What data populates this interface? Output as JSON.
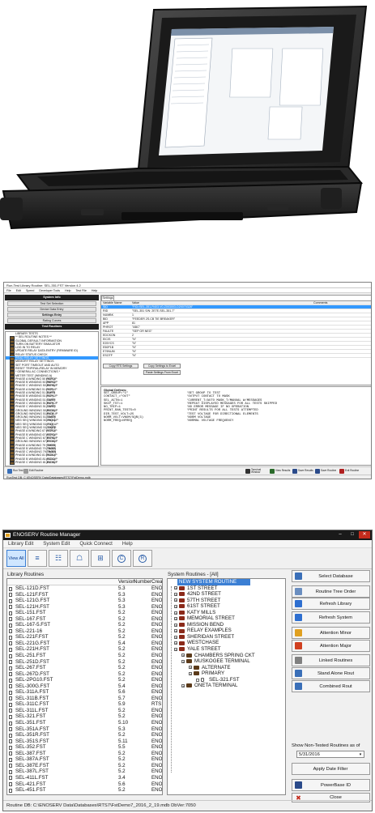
{
  "laptop_photo": {
    "description_icon": "rugged-laptop-photo"
  },
  "runtest": {
    "title": "Run-Test Library Routine: SEL-351.FST  Version 4.2",
    "menu": [
      "File",
      "Edit",
      "Speed",
      "Developer Tools",
      "Help",
      "Test File",
      "Help"
    ],
    "left": {
      "system_info": "System Info",
      "buttons": [
        "Test Set Selection",
        "Device Data Entry",
        "Settings Entry",
        "Rating Curves"
      ],
      "test_routines": "Test Routines",
      "tree": [
        {
          "label": "LIBRARY TESTS",
          "fst": ""
        },
        {
          "label": "** SEL ROUTINE NOTES **",
          "fst": ""
        },
        {
          "label": "GLOBAL DEFAULT INFORMATION",
          "fst": ""
        },
        {
          "label": "TURN ON BATTERY SIMULATOR",
          "fst": ""
        },
        {
          "label": "LOG IN TO RELAY",
          "fst": ""
        },
        {
          "label": "UPDATE RELAY DATA ENTRY (FIRMWARE ID)",
          "fst": ""
        },
        {
          "label": "RELAY STATUS CHECK",
          "fst": ""
        },
        {
          "label": "READ RELAY SETTINGS",
          "fst": "",
          "highlight": true
        },
        {
          "label": "MEMORY RELAY SETTINGS",
          "fst": ""
        },
        {
          "label": "SET PORT TIMEOUT AND AUTO",
          "fst": ""
        },
        {
          "label": "RESET TRIP/FAIL/RELAY IN MEMORY",
          "fst": ""
        },
        {
          "label": "* GENERAL AC CONNECTIONS *",
          "fst": ""
        },
        {
          "label": "METER TEST (WINDING A)",
          "fst": ""
        },
        {
          "label": "PHASE A WINDING 50 PICKUP",
          "fst": "(50P1)"
        },
        {
          "label": "PHASE B WINDING 50 PICKUP",
          "fst": "(50P2)"
        },
        {
          "label": "PHASE C WINDING 50 PICKUP",
          "fst": "(50P3)"
        },
        {
          "label": "PHASE A WINDING 51 PICKUP",
          "fst": "(51P)"
        },
        {
          "label": "PHASE A WINDING 51 TIMER",
          "fst": "(51PT)"
        },
        {
          "label": "PHASE B WINDING 51 PICKUP",
          "fst": "(51P)"
        },
        {
          "label": "PHASE B WINDING 51 TIMER",
          "fst": "(51PT)"
        },
        {
          "label": "PHASE C WINDING 51 PICKUP",
          "fst": "(51P)"
        },
        {
          "label": "PHASE C WINDING 51 TIMER",
          "fst": "(51PT)"
        },
        {
          "label": "GROUND WINDING 50 PICKUP",
          "fst": "(50G1)"
        },
        {
          "label": "GROUND WINDING 51 PICKUP",
          "fst": "(51G)"
        },
        {
          "label": "GROUND WINDING 51 TIMER",
          "fst": "(51GT)"
        },
        {
          "label": "NEG SEQ WINDING 50 PICKUP",
          "fst": "(50Q1)"
        },
        {
          "label": "NEG SEQ WINDING 51 PICKUP",
          "fst": "(51Q)"
        },
        {
          "label": "NEG SEQ WINDING 51 TIMER",
          "fst": "(51QT)"
        },
        {
          "label": "PHASE A WINDING 67 PICKUP",
          "fst": "(67P1)"
        },
        {
          "label": "PHASE B WINDING 67 PICKUP",
          "fst": "(67P2)"
        },
        {
          "label": "PHASE C WINDING 67 PICKUP",
          "fst": "(67P3)"
        },
        {
          "label": "GROUND WINDING 67 PICKUP",
          "fst": "(67G1)"
        },
        {
          "label": "PHASE A WINDING 79 TIMER",
          "fst": "(79OI1)"
        },
        {
          "label": "PHASE B WINDING 79 TIMER",
          "fst": "(79OI2)"
        },
        {
          "label": "PHASE C WINDING 79 TIMER",
          "fst": "(79OI3)"
        },
        {
          "label": "PHASE A WINDING 81 PICKUP",
          "fst": "(81D1)"
        },
        {
          "label": "PHASE B WINDING 81 PICKUP",
          "fst": "(81D2)"
        },
        {
          "label": "PHASE C WINDING 81 PICKUP",
          "fst": "(81D3)"
        }
      ]
    },
    "settings": {
      "tab": "Settings",
      "columns": [
        "Variable Name",
        "Value",
        "Comments"
      ],
      "rows": [
        {
          "name": "SID",
          "value": "\"FID=SEL-351-R403-V0-Z003003-D20070328\"",
          "selected": true
        },
        {
          "name": "RID",
          "value": "\"SEL-351 S/N: 2E7E-SEL-351-7\""
        },
        {
          "name": "NUMBK",
          "value": "1"
        },
        {
          "name": "BID",
          "value": "\"FEEDER 2S.CB TIE BREAKER\""
        },
        {
          "name": "APP",
          "value": "81"
        },
        {
          "name": "PHROT",
          "value": "\"ABC\""
        },
        {
          "name": "FAULTE",
          "value": "\"SEP OR NEG\""
        },
        {
          "name": "EDCKON",
          "value": "2"
        },
        {
          "name": "EICIS",
          "value": "\"N\""
        },
        {
          "name": "E25YCS",
          "value": "\"N\""
        },
        {
          "name": "E50P1B",
          "value": "\"N\""
        },
        {
          "name": "E79NUM",
          "value": "\"N\""
        },
        {
          "name": "ESOTF",
          "value": "\"N\""
        }
      ],
      "btn_copy_rts": "Copy RTS Settings",
      "btn_copy_excel": "Copy Settings to Excel",
      "btn_paste": "Paste Settings From Excel"
    },
    "globals": {
      "heading": "Global Defines:",
      "lines": [
        {
          "name": "SET_GROUP=\"1\"",
          "value": "'SET GROUP TO TEST"
        },
        {
          "name": "CONTACT_=\"OUT\"",
          "value": "'OUTPUT CONTACT TO MASK"
        },
        {
          "name": "SEL_ACTN=1",
          "value": "'CURRENT_T/AUTO MASK_T/MANUAL W/MESSAGES"
        },
        {
          "name": "SKIP_TST=1",
          "value": "'REPEAT DISPLAYED MESSAGES FOR ALL TESTS SKIPPED"
        },
        {
          "name": "NO_TRIP=1",
          "value": "'NO ERROR MESSAGE IF NO OPERATION"
        },
        {
          "name": "PRINT_RAN_TESTS=0",
          "value": "'PRINT RESULTS FOR ALL TESTS ATTEMPTED"
        },
        {
          "name": "DIR_TEST_VOLT=25",
          "value": "'TEST VOLTAGE FOR DIRECTIONAL ELEMENTS"
        },
        {
          "name": "NORM_VOLT=VNOM/SQR(3)",
          "value": "'NORM VOLTAGE"
        },
        {
          "name": "NORM_FREQ=NFREQ",
          "value": "'NORMAL VOLTAGE FREQUENCY"
        }
      ]
    },
    "bottom_left": [
      {
        "label": "Run Test",
        "icon": "run-icon",
        "color": "#3a6fb8"
      },
      {
        "label": "Edit Routine",
        "icon": "edit-icon",
        "color": "#9a9a9a"
      }
    ],
    "bottom_right": [
      {
        "label": "Terminal Window",
        "icon": "terminal-icon",
        "color": "#333333"
      },
      {
        "label": "View Results",
        "icon": "results-icon",
        "color": "#2a6a2a"
      },
      {
        "label": "Save Results",
        "icon": "save-icon",
        "color": "#2a4a8a"
      },
      {
        "label": "Save Routine",
        "icon": "save-routine-icon",
        "color": "#2a4a8a"
      },
      {
        "label": "Exit Routine",
        "icon": "exit-icon",
        "color": "#b02020"
      }
    ],
    "status": "RunTest DB: C:\\ENOSERV Data\\Databases\\RTS7\\FstDemo.mdb"
  },
  "rm": {
    "title": "ENOSERV Routine Manager",
    "menu": [
      "Library Edit",
      "System Edit",
      "Quick Connect",
      "Help"
    ],
    "toolbar": [
      {
        "label": "View All",
        "glyph": "",
        "icon": "view-all-icon",
        "active": true
      },
      {
        "label": "",
        "glyph": "≡",
        "icon": "tree-icon"
      },
      {
        "label": "",
        "glyph": "☷",
        "icon": "grid-icon"
      },
      {
        "label": "",
        "glyph": "☖",
        "icon": "document-icon"
      },
      {
        "label": "",
        "glyph": "⊞",
        "icon": "network-icon"
      },
      {
        "label": "",
        "glyph": "C",
        "icon": "c-circle-icon",
        "circle": true
      },
      {
        "label": "",
        "glyph": "R",
        "icon": "r-circle-icon",
        "circle": true
      }
    ],
    "library_heading": "Library Routines",
    "columns": {
      "version": "Version",
      "number": "Number",
      "creator": "Crea"
    },
    "library": [
      {
        "name": "SEL-121D.FST",
        "ver": "5.3",
        "crea": "ENO"
      },
      {
        "name": "SEL-121F.FST",
        "ver": "5.3",
        "crea": "ENO"
      },
      {
        "name": "SEL-121G.FST",
        "ver": "5.3",
        "crea": "ENO"
      },
      {
        "name": "SEL-121H.FST",
        "ver": "5.3",
        "crea": "ENO"
      },
      {
        "name": "SEL-151.FST",
        "ver": "5.2",
        "crea": "ENO"
      },
      {
        "name": "SEL-167.FST",
        "ver": "5.2",
        "crea": "ENO"
      },
      {
        "name": "SEL-167-5.FST",
        "ver": "5.2",
        "crea": "ENO"
      },
      {
        "name": "SEL-221-16",
        "ver": "5.2",
        "crea": "ENO"
      },
      {
        "name": "SEL-221F.FST",
        "ver": "5.2",
        "crea": "ENO"
      },
      {
        "name": "SEL-221G.FST",
        "ver": "5.4",
        "crea": "ENO"
      },
      {
        "name": "SEL-221H.FST",
        "ver": "5.2",
        "crea": "ENO"
      },
      {
        "name": "SEL-251.FST",
        "ver": "5.2",
        "crea": "ENO"
      },
      {
        "name": "SEL-251D.FST",
        "ver": "5.2",
        "crea": "ENO"
      },
      {
        "name": "SEL-267.FST",
        "ver": "5.2",
        "crea": "ENO"
      },
      {
        "name": "SEL-267D.FST",
        "ver": "5.2",
        "crea": "ENO"
      },
      {
        "name": "SEL-2PG10.FST",
        "ver": "5.2",
        "crea": "ENO"
      },
      {
        "name": "SEL-300G.FST",
        "ver": "5.4",
        "crea": "ENO"
      },
      {
        "name": "SEL-311A.FST",
        "ver": "5.6",
        "crea": "ENO"
      },
      {
        "name": "SEL-311B.FST",
        "ver": "5.7",
        "crea": "ENO"
      },
      {
        "name": "SEL-311C.FST",
        "ver": "5.9",
        "crea": "RTS"
      },
      {
        "name": "SEL-311L.FST",
        "ver": "5.2",
        "crea": "ENO"
      },
      {
        "name": "SEL-321.FST",
        "ver": "5.2",
        "crea": "ENO"
      },
      {
        "name": "SEL-351.FST",
        "ver": "5.10",
        "crea": "ENO"
      },
      {
        "name": "SEL-351A.FST",
        "ver": "5.3",
        "crea": "ENO"
      },
      {
        "name": "SEL-351R.FST",
        "ver": "5.2",
        "crea": "ENO"
      },
      {
        "name": "SEL-351S.FST",
        "ver": "5.11",
        "crea": "ENO"
      },
      {
        "name": "SEL-352.FST",
        "ver": "5.5",
        "crea": "ENO"
      },
      {
        "name": "SEL-387.FST",
        "ver": "5.2",
        "crea": "ENO"
      },
      {
        "name": "SEL-387A.FST",
        "ver": "5.2",
        "crea": "ENO"
      },
      {
        "name": "SEL-387E.FST",
        "ver": "5.2",
        "crea": "ENO"
      },
      {
        "name": "SEL-387L.FST",
        "ver": "5.2",
        "crea": "ENO"
      },
      {
        "name": "SEL-411L.FST",
        "ver": "3.4",
        "crea": "ENO"
      },
      {
        "name": "SEL-421.FST",
        "ver": "5.6",
        "crea": "ENO"
      },
      {
        "name": "SEL-451.FST",
        "ver": "5.2",
        "crea": "ENO"
      }
    ],
    "system_heading": "System Routines - [All]",
    "system": [
      {
        "label": "NEW SYSTEM ROUTINE",
        "level": 0,
        "first": true
      },
      {
        "label": "1ST STREET",
        "level": 1
      },
      {
        "label": "42ND STREET",
        "level": 1
      },
      {
        "label": "57TH STREET",
        "level": 1
      },
      {
        "label": "61ST STREET",
        "level": 1
      },
      {
        "label": "KATY MILLS",
        "level": 1
      },
      {
        "label": "MEMORIAL STREET",
        "level": 1
      },
      {
        "label": "MISSION BEND",
        "level": 1
      },
      {
        "label": "RELAY EXAMPLES",
        "level": 1
      },
      {
        "label": "SHERIDAN STREET",
        "level": 1
      },
      {
        "label": "WESTCHASE",
        "level": 1
      },
      {
        "label": "YALE STREET",
        "level": 1
      },
      {
        "label": "CHAMBERS SPRING CKT",
        "level": 2
      },
      {
        "label": "MUSKOGEE TERMINAL",
        "level": 2
      },
      {
        "label": "ALTERNATE",
        "level": 3
      },
      {
        "label": "PRIMARY",
        "level": 3
      },
      {
        "label": "SEL-321.FST",
        "level": 4,
        "file": true
      },
      {
        "label": "ONETA TERMINAL",
        "level": 2
      }
    ],
    "buttons": [
      {
        "label": "Select Database",
        "icon": "database-icon",
        "color": "#3a6fb8"
      },
      {
        "label": "Routine Tree Order",
        "icon": "tree-order-icon",
        "color": "#6a8ec0"
      },
      {
        "label": "Refresh Library",
        "icon": "refresh-library-icon",
        "color": "#2e6fd0"
      },
      {
        "label": "Refresh System",
        "icon": "refresh-system-icon",
        "color": "#2e6fd0"
      },
      {
        "label": "Attention Minor",
        "icon": "attention-minor-icon",
        "color": "#e0a020"
      },
      {
        "label": "Attention Major",
        "icon": "attention-major-icon",
        "color": "#d04020"
      },
      {
        "label": "Linked Routines",
        "icon": "linked-icon",
        "color": "#808080"
      },
      {
        "label": "Stand Alone Rout",
        "icon": "standalone-icon",
        "color": "#3a6fb8"
      },
      {
        "label": "Combined Rout",
        "icon": "combined-icon",
        "color": "#3a6fb8"
      }
    ],
    "show_not_tested": "Show Non-Tested Routines as of",
    "date": "5/31/2016",
    "apply_date": "Apply Date Filter",
    "powerbase": "PowerBase ID",
    "close": "Close",
    "status": "Routine DB:  C:\\ENOSERV Data\\Databases\\RTS7\\FstDemo7_2016_2_19.mdb DbVer:7050"
  }
}
